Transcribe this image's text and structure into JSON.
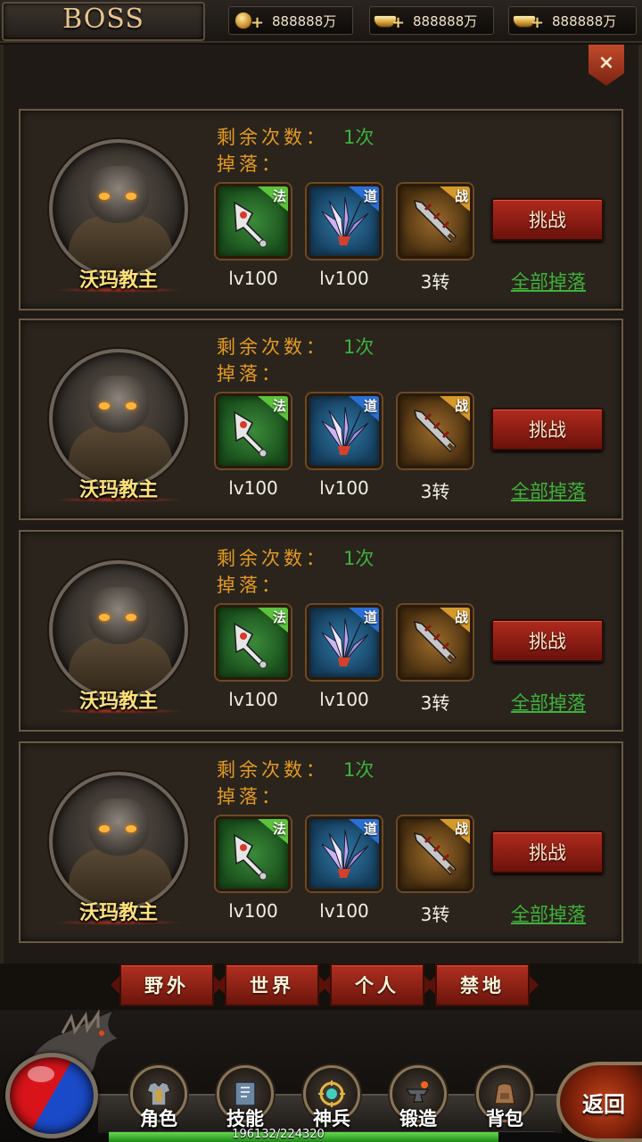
{
  "header": {
    "title": "BOSS",
    "currencies": [
      {
        "icon": "coin-icon",
        "value": "888888万"
      },
      {
        "icon": "gold-ingot-icon",
        "value": "888888万"
      },
      {
        "icon": "gold-ingot-icon",
        "value": "888888万"
      }
    ],
    "close_label": "×"
  },
  "boss_cards": [
    {
      "name": "沃玛教主",
      "remain_label": "剩余次数：",
      "remain_value": "1次",
      "drop_label": "掉落：",
      "items": [
        {
          "tag": "法",
          "caption": "lv100",
          "rarity_color": "#5cc33c"
        },
        {
          "tag": "道",
          "caption": "lv100",
          "rarity_color": "#2a6fd6"
        },
        {
          "tag": "战",
          "caption": "3转",
          "rarity_color": "#d69a2a"
        }
      ],
      "challenge_label": "挑战",
      "all_drops_label": "全部掉落"
    },
    {
      "name": "沃玛教主",
      "remain_label": "剩余次数：",
      "remain_value": "1次",
      "drop_label": "掉落：",
      "items": [
        {
          "tag": "法",
          "caption": "lv100",
          "rarity_color": "#5cc33c"
        },
        {
          "tag": "道",
          "caption": "lv100",
          "rarity_color": "#2a6fd6"
        },
        {
          "tag": "战",
          "caption": "3转",
          "rarity_color": "#d69a2a"
        }
      ],
      "challenge_label": "挑战",
      "all_drops_label": "全部掉落"
    },
    {
      "name": "沃玛教主",
      "remain_label": "剩余次数：",
      "remain_value": "1次",
      "drop_label": "掉落：",
      "items": [
        {
          "tag": "法",
          "caption": "lv100",
          "rarity_color": "#5cc33c"
        },
        {
          "tag": "道",
          "caption": "lv100",
          "rarity_color": "#2a6fd6"
        },
        {
          "tag": "战",
          "caption": "3转",
          "rarity_color": "#d69a2a"
        }
      ],
      "challenge_label": "挑战",
      "all_drops_label": "全部掉落"
    },
    {
      "name": "沃玛教主",
      "remain_label": "剩余次数：",
      "remain_value": "1次",
      "drop_label": "掉落：",
      "items": [
        {
          "tag": "法",
          "caption": "lv100",
          "rarity_color": "#5cc33c"
        },
        {
          "tag": "道",
          "caption": "lv100",
          "rarity_color": "#2a6fd6"
        },
        {
          "tag": "战",
          "caption": "3转",
          "rarity_color": "#d69a2a"
        }
      ],
      "challenge_label": "挑战",
      "all_drops_label": "全部掉落"
    }
  ],
  "category_tabs": [
    "野外",
    "世界",
    "个人",
    "禁地"
  ],
  "bottom_nav": [
    {
      "label": "角色",
      "icon": "armor-icon"
    },
    {
      "label": "技能",
      "icon": "skill-book-icon"
    },
    {
      "label": "神兵",
      "icon": "divine-weapon-icon"
    },
    {
      "label": "锻造",
      "icon": "anvil-icon"
    },
    {
      "label": "背包",
      "icon": "backpack-icon"
    }
  ],
  "return_label": "返回",
  "experience": {
    "text": "196132/224320",
    "fraction": 0.874
  },
  "colors": {
    "label_orange": "#e39a22",
    "value_green": "#3db33d",
    "boss_name_gold": "#ffe07a",
    "button_red": "#b02a1e"
  }
}
